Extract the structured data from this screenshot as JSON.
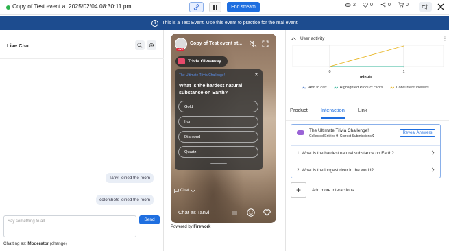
{
  "header": {
    "title": "Copy of Test event at 2025/02/04 08:30:11 pm",
    "end_stream_label": "End stream",
    "stats": {
      "viewers": "2",
      "likes": "0",
      "shares": "0",
      "cart": "0"
    }
  },
  "banner": {
    "text": "This is a Test Event. Use this event to practice for the real event"
  },
  "chat": {
    "title": "Live Chat",
    "messages": [
      "Tanvi joined the room",
      "colorshots joined the room"
    ],
    "input_placeholder": "Say something to all",
    "send_label": "Send",
    "chatting_as_prefix": "Chatting as:",
    "role": "Moderator",
    "change_label": "change"
  },
  "preview": {
    "stream_title": "Copy of Test event at...",
    "live_badge": "LIVE",
    "giveaway_label": "Trivia Giveaway",
    "trivia_header": "The Ultimate Trivia Challenge!",
    "question": "What is the hardest natural substance on Earth?",
    "options": [
      "Gold",
      "Iron",
      "Diamond",
      "Quartz"
    ],
    "chat_toggle": "Chat",
    "chat_as": "Chat as Tanvi",
    "powered_by": "Powered by",
    "brand": "Firework"
  },
  "activity": {
    "title": "User activity",
    "chart_data": {
      "type": "line",
      "x": [
        0,
        1
      ],
      "xlabel": "minute",
      "series": [
        {
          "name": "Add to cart",
          "values": [
            0,
            0
          ]
        },
        {
          "name": "Highlighted Product clicks",
          "values": [
            0,
            0
          ]
        },
        {
          "name": "Concurrent Viewers",
          "values": [
            0,
            2
          ]
        }
      ],
      "tick_labels": [
        "0",
        "1"
      ]
    },
    "legend": [
      "Add to cart",
      "Highlighted Product clicks",
      "Concurrent Viewers"
    ],
    "colors": {
      "add_to_cart": "#4a78c8",
      "product_clicks": "#33b59a",
      "concurrent": "#e8b624"
    }
  },
  "tabs": [
    "Product",
    "Interaction",
    "Link"
  ],
  "interaction": {
    "title": "The Ultimate Trivia Challenge!",
    "collected_label": "Collected Entries",
    "collected_value": "0",
    "correct_label": "Correct Submissions",
    "correct_value": "0",
    "reveal_label": "Reveal Answers",
    "questions": [
      "1. What is the hardest natural substance on Earth?",
      "2. What is the longest river in the world?"
    ],
    "add_more_label": "Add more interactions"
  }
}
